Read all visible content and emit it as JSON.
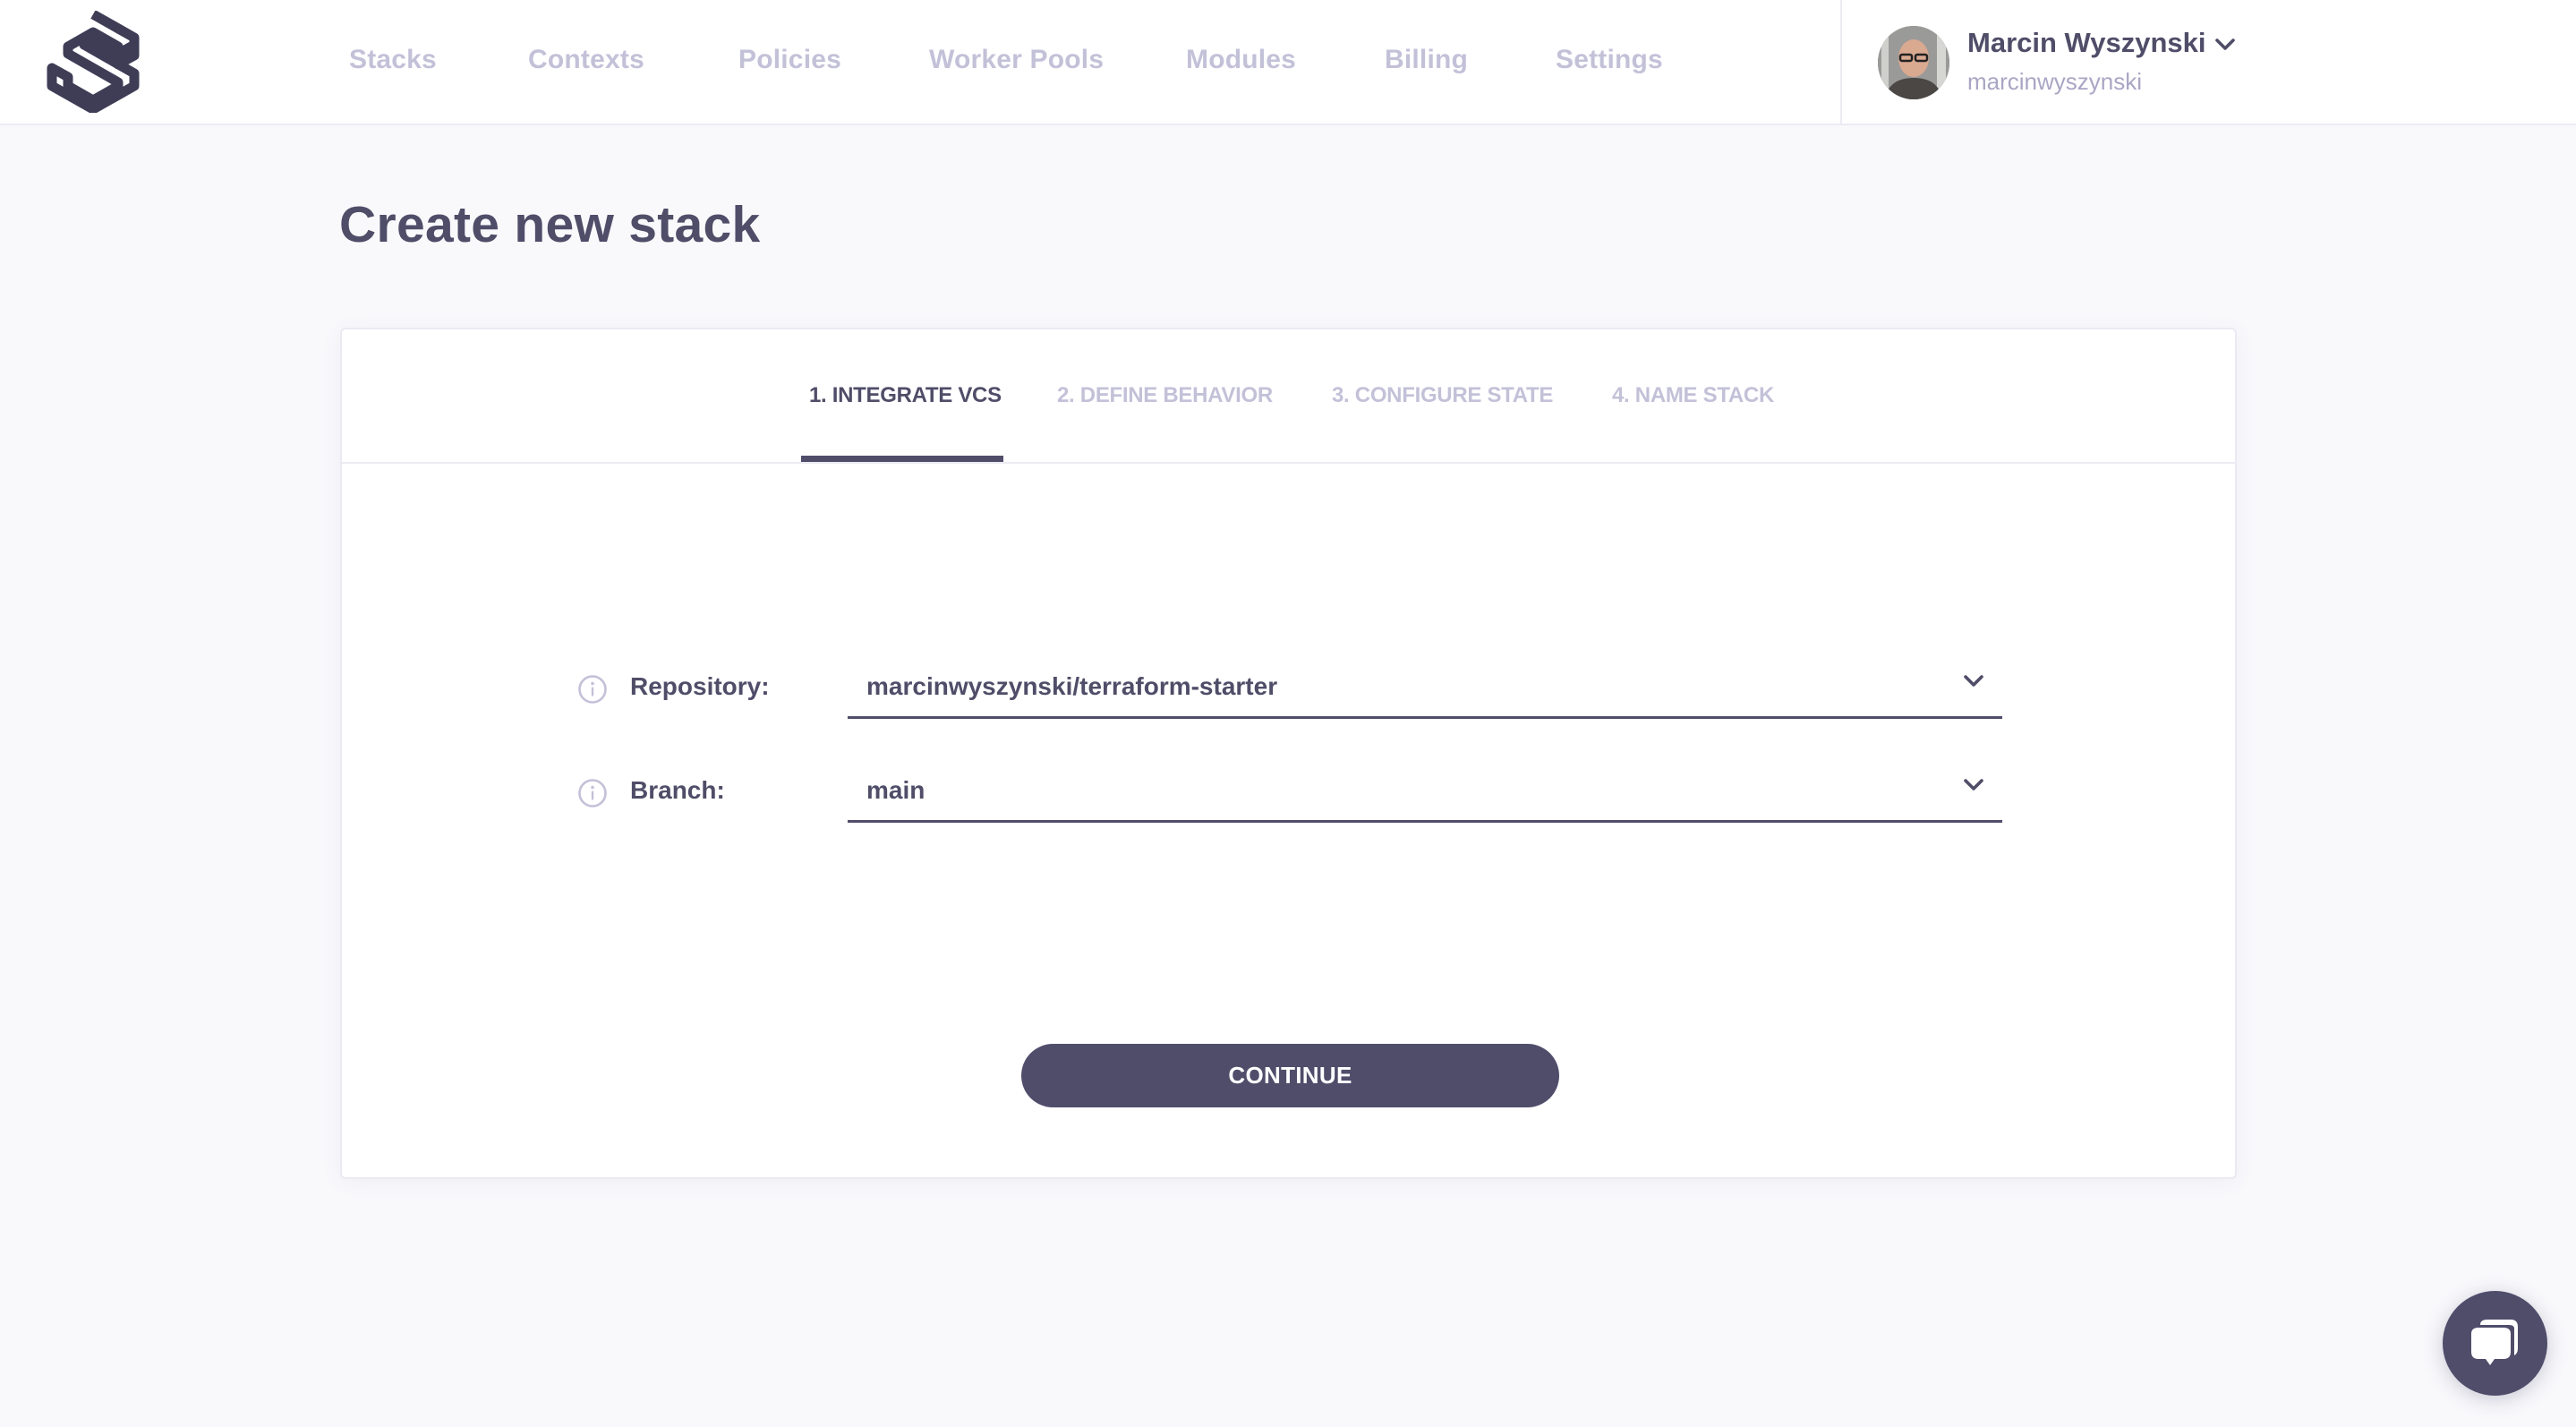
{
  "header": {
    "logo": "spacelift-logo",
    "nav": [
      {
        "label": "Stacks"
      },
      {
        "label": "Contexts"
      },
      {
        "label": "Policies"
      },
      {
        "label": "Worker Pools"
      },
      {
        "label": "Modules"
      },
      {
        "label": "Billing"
      },
      {
        "label": "Settings"
      }
    ],
    "user": {
      "name": "Marcin Wyszynski",
      "login": "marcinwyszynski",
      "avatar": "user-avatar-photo"
    }
  },
  "page": {
    "title": "Create new stack"
  },
  "wizard": {
    "tabs": [
      {
        "label": "1. INTEGRATE VCS",
        "active": true
      },
      {
        "label": "2. DEFINE BEHAVIOR",
        "active": false
      },
      {
        "label": "3. CONFIGURE STATE",
        "active": false
      },
      {
        "label": "4. NAME STACK",
        "active": false
      }
    ],
    "fields": {
      "repository": {
        "label": "Repository:",
        "value": "marcinwyszynski/terraform-starter"
      },
      "branch": {
        "label": "Branch:",
        "value": "main"
      }
    },
    "continue_label": "CONTINUE"
  },
  "colors": {
    "primary": "#504d6b",
    "muted": "#c3c1d8",
    "background": "#f9f9fc"
  },
  "chat": {
    "icon": "chat-bubbles-icon"
  }
}
